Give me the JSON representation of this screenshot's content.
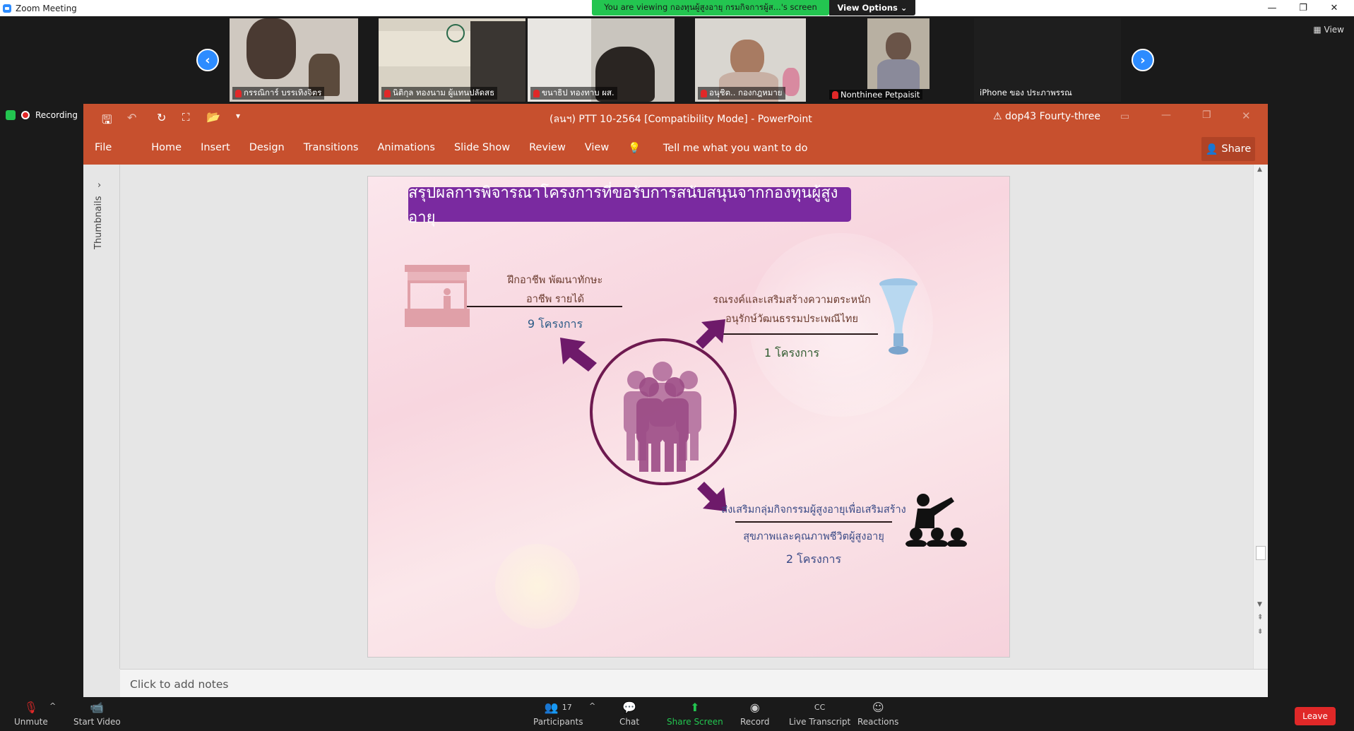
{
  "window": {
    "title": "Zoom Meeting"
  },
  "share_banner": "You are viewing กองทุนผู้สูงอายุ กรมกิจการผู้ส...'s screen",
  "view_options": "View Options",
  "view_label": "View",
  "participants_strip": [
    {
      "name": "กรรณิการ์ บรรเทิงจิตร"
    },
    {
      "name": "นิติกุล ทองนาม ผู้แทนปลัดสธ"
    },
    {
      "name": "ขนาธิป ทองทาบ ผส."
    },
    {
      "name": "อนุชิต.. กองกฎหมาย"
    },
    {
      "name": "Nonthinee Petpaisit"
    },
    {
      "name": "iPhone ของ ประภาพรรณ"
    }
  ],
  "recording_label": "Recording",
  "ppt": {
    "title": "(ลนฯ) PTT 10-2564 [Compatibility Mode]  -  PowerPoint",
    "warning_user": "dop43 Fourty-three",
    "tabs": [
      "File",
      "Home",
      "Insert",
      "Design",
      "Transitions",
      "Animations",
      "Slide Show",
      "Review",
      "View"
    ],
    "tell_me": "Tell me what you want to do",
    "share": "Share",
    "thumbnails": "Thumbnails",
    "notes_placeholder": "Click to add notes"
  },
  "slide": {
    "banner": "สรุปผลการพิจารณาโครงการที่ขอรับการสนับสนุนจากกองทุนผู้สูงอายุ",
    "item1_line1": "ฝึกอาชีพ พัฒนาทักษะ",
    "item1_line2": "อาชีพ รายได้",
    "item1_count": "9 โครงการ",
    "item2_line1": "รณรงค์และเสริมสร้างความตระหนัก",
    "item2_line2": "อนุรักษ์วัฒนธรรมประเพณีไทย",
    "item2_count": "1 โครงการ",
    "item3_line1": "ส่งเสริมกลุ่มกิจกรรมผู้สูงอายุเพื่อเสริมสร้าง",
    "item3_line2": "สุขภาพและคุณภาพชีวิตผู้สูงอายุ",
    "item3_count": "2 โครงการ"
  },
  "toolbar": {
    "unmute": "Unmute",
    "start_video": "Start Video",
    "participants": "Participants",
    "participants_count": "17",
    "chat": "Chat",
    "share_screen": "Share Screen",
    "record": "Record",
    "live_transcript": "Live Transcript",
    "reactions": "Reactions",
    "leave": "Leave"
  },
  "colors": {
    "zoom_blue": "#2d8cff",
    "ppt_orange": "#c7502e",
    "banner_purple": "#7a2aa0",
    "share_green": "#23c550",
    "leave_red": "#e02828"
  }
}
